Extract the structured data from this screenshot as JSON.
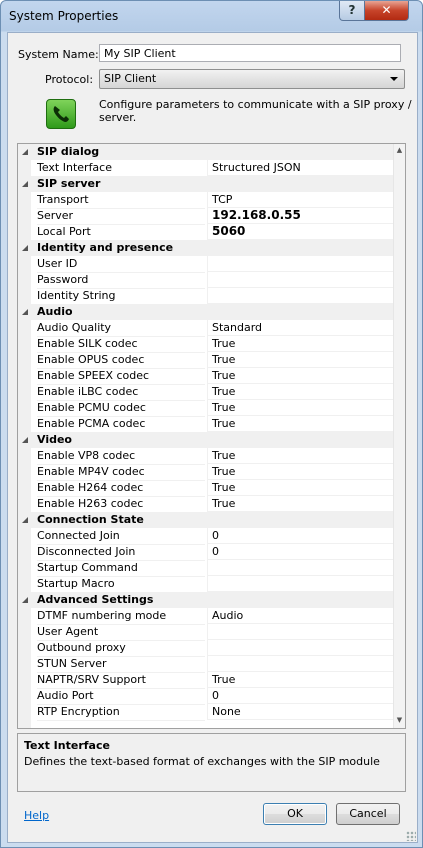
{
  "window": {
    "title": "System Properties",
    "help_glyph": "?",
    "close_glyph": "✕"
  },
  "form": {
    "system_name_label": "System Name:",
    "system_name_value": "My SIP Client",
    "protocol_label": "Protocol:",
    "protocol_value": "SIP Client",
    "description": "Configure parameters to communicate with a SIP proxy / server.",
    "icon": "phone-icon"
  },
  "properties": {
    "sip_dialog": {
      "label": "SIP dialog",
      "rows": [
        {
          "name": "Text Interface",
          "value": "Structured JSON"
        }
      ]
    },
    "sip_server": {
      "label": "SIP server",
      "rows": [
        {
          "name": "Transport",
          "value": "TCP"
        },
        {
          "name": "Server",
          "value": "192.168.0.55"
        },
        {
          "name": "Local Port",
          "value": "5060"
        }
      ]
    },
    "identity": {
      "label": "Identity and presence",
      "rows": [
        {
          "name": "User ID",
          "value": ""
        },
        {
          "name": "Password",
          "value": ""
        },
        {
          "name": "Identity String",
          "value": ""
        }
      ]
    },
    "audio": {
      "label": "Audio",
      "rows": [
        {
          "name": "Audio Quality",
          "value": "Standard"
        },
        {
          "name": "Enable SILK codec",
          "value": "True"
        },
        {
          "name": "Enable OPUS codec",
          "value": "True"
        },
        {
          "name": "Enable SPEEX codec",
          "value": "True"
        },
        {
          "name": "Enable iLBC codec",
          "value": "True"
        },
        {
          "name": "Enable PCMU codec",
          "value": "True"
        },
        {
          "name": "Enable PCMA codec",
          "value": "True"
        }
      ]
    },
    "video": {
      "label": "Video",
      "rows": [
        {
          "name": "Enable VP8 codec",
          "value": "True"
        },
        {
          "name": "Enable MP4V codec",
          "value": "True"
        },
        {
          "name": "Enable H264 codec",
          "value": "True"
        },
        {
          "name": "Enable H263 codec",
          "value": "True"
        }
      ]
    },
    "connection_state": {
      "label": "Connection State",
      "rows": [
        {
          "name": "Connected Join",
          "value": "0"
        },
        {
          "name": "Disconnected Join",
          "value": "0"
        },
        {
          "name": "Startup Command",
          "value": ""
        },
        {
          "name": "Startup Macro",
          "value": ""
        }
      ]
    },
    "advanced": {
      "label": "Advanced Settings",
      "rows": [
        {
          "name": "DTMF numbering mode",
          "value": "Audio"
        },
        {
          "name": "User Agent",
          "value": ""
        },
        {
          "name": "Outbound proxy",
          "value": ""
        },
        {
          "name": "STUN Server",
          "value": ""
        },
        {
          "name": "NAPTR/SRV Support",
          "value": "True"
        },
        {
          "name": "Audio Port",
          "value": "0"
        },
        {
          "name": "RTP Encryption",
          "value": "None"
        }
      ]
    }
  },
  "help_panel": {
    "title": "Text Interface",
    "text": "Defines the text-based format of exchanges with the SIP module"
  },
  "footer": {
    "help_link": "Help",
    "ok_label": "OK",
    "cancel_label": "Cancel"
  }
}
